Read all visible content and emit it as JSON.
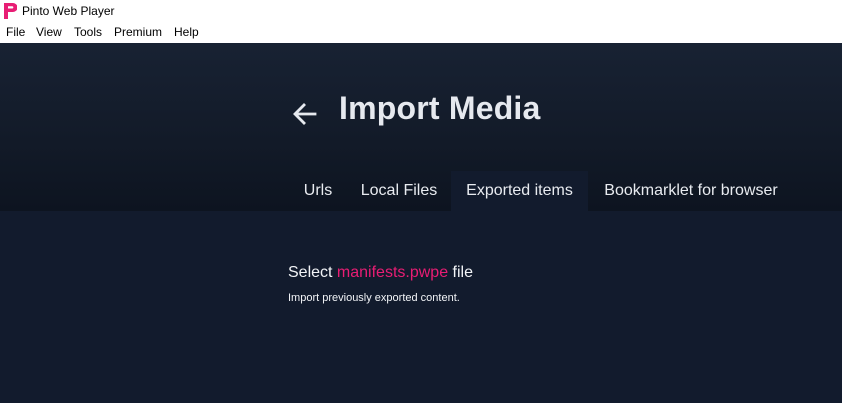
{
  "app": {
    "title": "Pinto Web Player",
    "accent_color": "#e81d74",
    "logo_icon": "pinto-logo-icon"
  },
  "menubar": {
    "items": [
      "File",
      "View",
      "Tools",
      "Premium",
      "Help"
    ]
  },
  "header": {
    "title": "Import Media",
    "back_icon": "arrow-left-icon"
  },
  "tabs": [
    {
      "label": "Urls",
      "active": false
    },
    {
      "label": "Local Files",
      "active": false
    },
    {
      "label": "Exported items",
      "active": true
    },
    {
      "label": "Bookmarklet for browser",
      "active": false
    }
  ],
  "content": {
    "select_prefix": "Select ",
    "select_link": "manifests.pwpe",
    "select_suffix": " file",
    "description": "Import previously exported content."
  }
}
